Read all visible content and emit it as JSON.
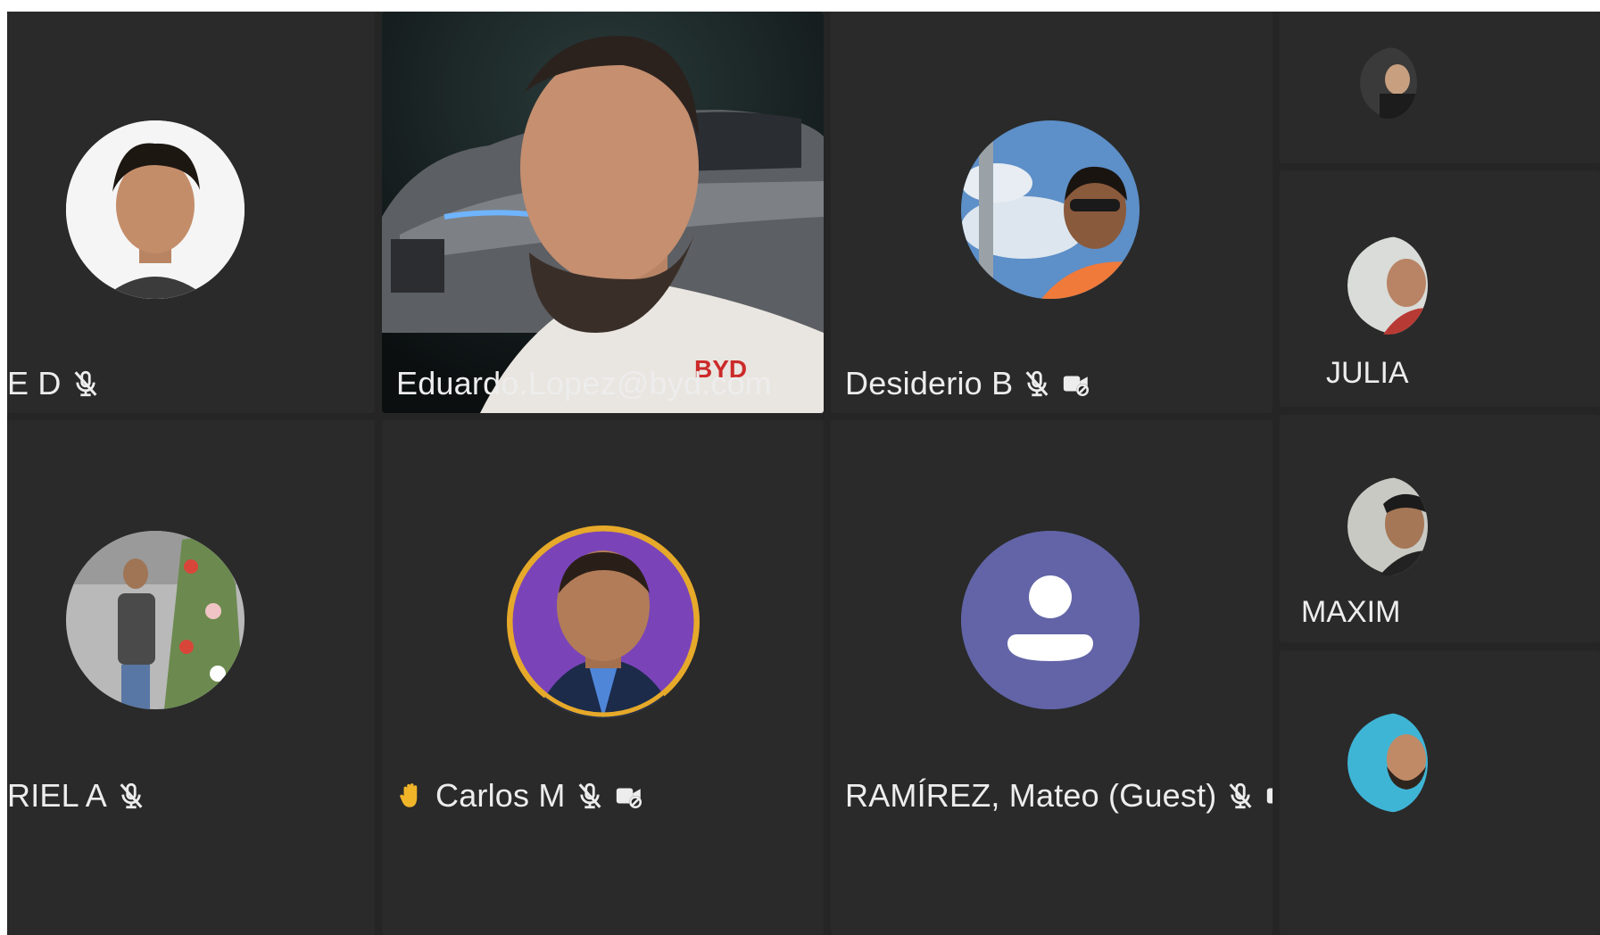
{
  "participants": [
    {
      "name": "E D",
      "mic_muted": true,
      "camera_off": false
    },
    {
      "name": "Eduardo.Lopez@byd.com",
      "active_speaker": true,
      "shirt_logo": "BYD"
    },
    {
      "name": "Desiderio B",
      "mic_muted": true,
      "camera_off": true
    },
    {
      "name": "RIEL A",
      "mic_muted": true,
      "camera_off": false
    },
    {
      "name": "Carlos M",
      "hand_raised": true,
      "mic_muted": true,
      "camera_off": true
    },
    {
      "name": "RAMÍREZ, Mateo (Guest)",
      "mic_muted": true,
      "camera_off": true
    }
  ],
  "side_participants": [
    {
      "name": ""
    },
    {
      "name": "JULIA"
    },
    {
      "name": "MAXIM"
    },
    {
      "name": ""
    }
  ],
  "icons": {
    "mic_muted": "mic-off-icon",
    "camera_off": "camera-off-icon",
    "hand_raised": "raised-hand-icon",
    "default_avatar": "person-icon"
  },
  "colors": {
    "stage_bg": "#252525",
    "tile_bg": "#2a2a2a",
    "active_border": "#6b6eb5",
    "hand_ring": "#e6a92a",
    "default_avatar_bg": "#6264a7",
    "hand_icon": "#f0b429"
  }
}
